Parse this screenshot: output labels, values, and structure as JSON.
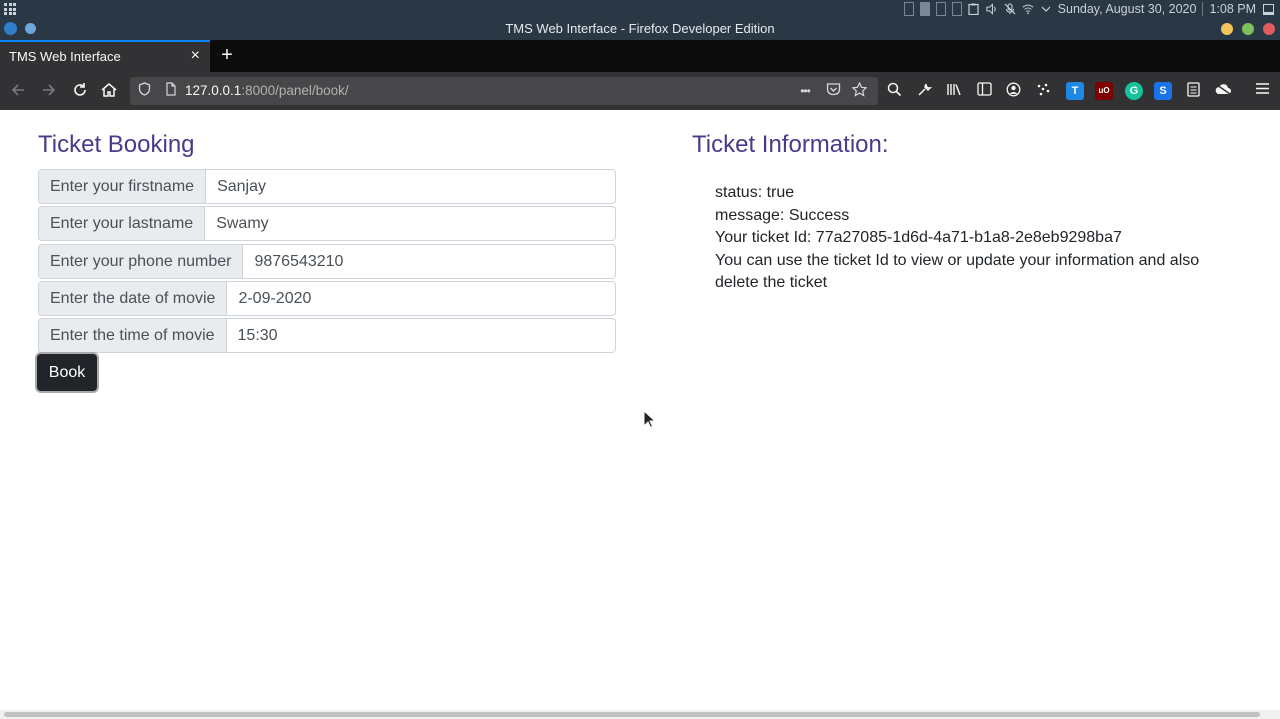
{
  "os_panel": {
    "date": "Sunday, August 30, 2020",
    "time": "1:08 PM"
  },
  "window": {
    "title": "TMS Web Interface - Firefox Developer Edition"
  },
  "tab": {
    "label": "TMS Web Interface",
    "close": "×",
    "new_tab": "+"
  },
  "navbar": {
    "url_host": "127.0.0.1",
    "url_rest": ":8000/panel/book/",
    "page_actions": "•••"
  },
  "form": {
    "heading": "Ticket Booking",
    "fields": [
      {
        "label": "Enter your firstname",
        "value": "Sanjay"
      },
      {
        "label": "Enter your lastname",
        "value": "Swamy"
      },
      {
        "label": "Enter your phone number",
        "value": "9876543210"
      },
      {
        "label": "Enter the date of movie",
        "value": "2-09-2020"
      },
      {
        "label": "Enter the time of movie",
        "value": "15:30"
      }
    ],
    "submit": "Book"
  },
  "info": {
    "heading": "Ticket Information:",
    "lines": [
      "status: true",
      "message: Success",
      "Your ticket Id: 77a27085-1d6d-4a71-b1a8-2e8eb9298ba7",
      "You can use the ticket Id to view or update your information and also delete the ticket"
    ]
  },
  "colors": {
    "heading": "#4a3a8a",
    "button": "#212529",
    "os_panel": "#2a3744",
    "tab_active_accent": "#0a84ff",
    "window_close": "#e05d5d",
    "window_max": "#7cc05c",
    "window_min": "#f2c55c"
  }
}
